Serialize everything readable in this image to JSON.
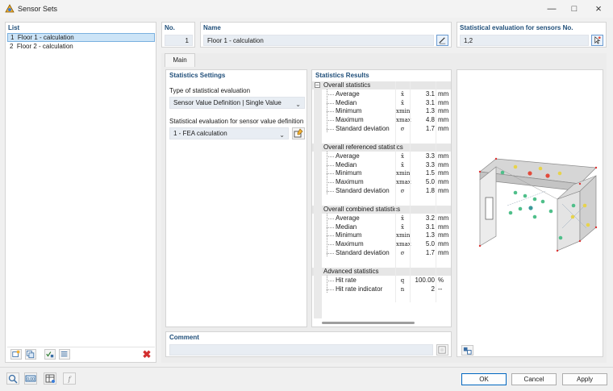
{
  "window": {
    "title": "Sensor Sets"
  },
  "list": {
    "header": "List",
    "items": [
      {
        "no": "1",
        "name": "Floor 1 - calculation"
      },
      {
        "no": "2",
        "name": "Floor 2 - calculation"
      }
    ]
  },
  "header": {
    "no_label": "No.",
    "no_value": "1",
    "name_label": "Name",
    "name_value": "Floor 1 - calculation",
    "stat_label": "Statistical evaluation for sensors No.",
    "stat_value": "1,2"
  },
  "tabs": [
    {
      "label": "Main",
      "active": true
    }
  ],
  "settings": {
    "title": "Statistics Settings",
    "type_label": "Type of statistical evaluation",
    "type_value": "Sensor Value Definition | Single Value",
    "def_label": "Statistical evaluation for sensor value definition",
    "def_value": "1 - FEA calculation"
  },
  "results": {
    "title": "Statistics Results",
    "sections": [
      {
        "name": "Overall statistics",
        "rows": [
          {
            "label": "Average",
            "sym": "x̄",
            "value": "3.1",
            "unit": "mm"
          },
          {
            "label": "Median",
            "sym": "x̃",
            "value": "3.1",
            "unit": "mm"
          },
          {
            "label": "Minimum",
            "sym": "xmin",
            "value": "1.3",
            "unit": "mm"
          },
          {
            "label": "Maximum",
            "sym": "xmax",
            "value": "4.8",
            "unit": "mm"
          },
          {
            "label": "Standard deviation",
            "sym": "σ",
            "value": "1.7",
            "unit": "mm"
          }
        ]
      },
      {
        "name": "Overall referenced statistics",
        "rows": [
          {
            "label": "Average",
            "sym": "x̄",
            "value": "3.3",
            "unit": "mm"
          },
          {
            "label": "Median",
            "sym": "x̃",
            "value": "3.3",
            "unit": "mm"
          },
          {
            "label": "Minimum",
            "sym": "xmin",
            "value": "1.5",
            "unit": "mm"
          },
          {
            "label": "Maximum",
            "sym": "xmax",
            "value": "5.0",
            "unit": "mm"
          },
          {
            "label": "Standard deviation",
            "sym": "σ",
            "value": "1.8",
            "unit": "mm"
          }
        ]
      },
      {
        "name": "Overall combined statistics",
        "rows": [
          {
            "label": "Average",
            "sym": "x̄",
            "value": "3.2",
            "unit": "mm"
          },
          {
            "label": "Median",
            "sym": "x̃",
            "value": "3.1",
            "unit": "mm"
          },
          {
            "label": "Minimum",
            "sym": "xmin",
            "value": "1.3",
            "unit": "mm"
          },
          {
            "label": "Maximum",
            "sym": "xmax",
            "value": "5.0",
            "unit": "mm"
          },
          {
            "label": "Standard deviation",
            "sym": "σ",
            "value": "1.7",
            "unit": "mm"
          }
        ]
      },
      {
        "name": "Advanced statistics",
        "rows": [
          {
            "label": "Hit rate",
            "sym": "q",
            "value": "100.00",
            "unit": "%"
          },
          {
            "label": "Hit rate indicator",
            "sym": "n",
            "value": "2",
            "unit": "--"
          }
        ]
      }
    ]
  },
  "comment": {
    "label": "Comment",
    "value": ""
  },
  "footer": {
    "ok": "OK",
    "cancel": "Cancel",
    "apply": "Apply"
  },
  "colors": {
    "accent": "#1f4e79",
    "selection": "#cce4f7",
    "field": "#e8edf3",
    "sensor_red": "#e24a3b",
    "sensor_green": "#4fbf8a",
    "sensor_yellow": "#e7d34b"
  }
}
